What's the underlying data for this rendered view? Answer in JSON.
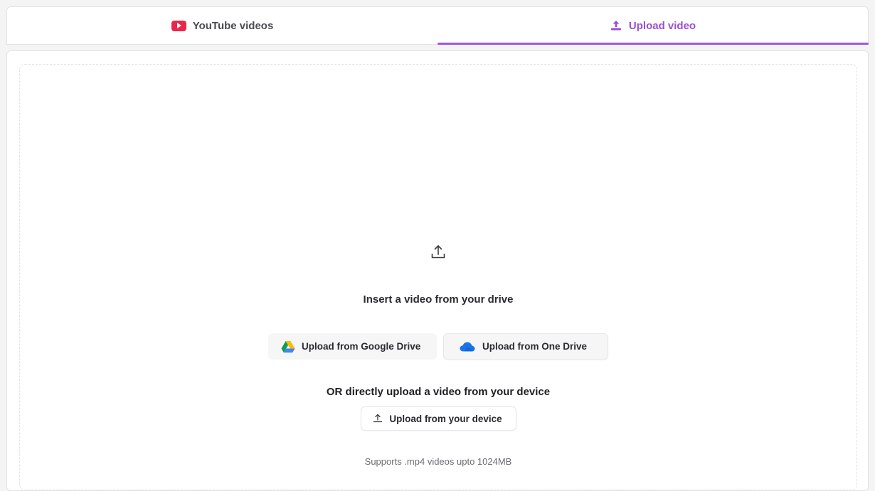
{
  "tabs": {
    "youtube_label": "YouTube videos",
    "upload_label": "Upload video",
    "active": "upload"
  },
  "upload": {
    "drive_heading": "Insert a video from your drive",
    "google_drive_label": "Upload from Google Drive",
    "one_drive_label": "Upload from One Drive",
    "or_heading": "OR directly upload a video from your device",
    "device_label": "Upload from your device",
    "supports_text": "Supports .mp4 videos upto 1024MB"
  },
  "icons": {
    "youtube": "youtube-icon",
    "upload_tab": "upload-icon",
    "dropzone": "upload-icon",
    "google_drive": "google-drive-icon",
    "one_drive": "onedrive-cloud-icon",
    "device": "upload-icon"
  },
  "colors": {
    "accent": "#a056dd",
    "youtube_red": "#e8274b",
    "onedrive_blue": "#1a73e8"
  }
}
